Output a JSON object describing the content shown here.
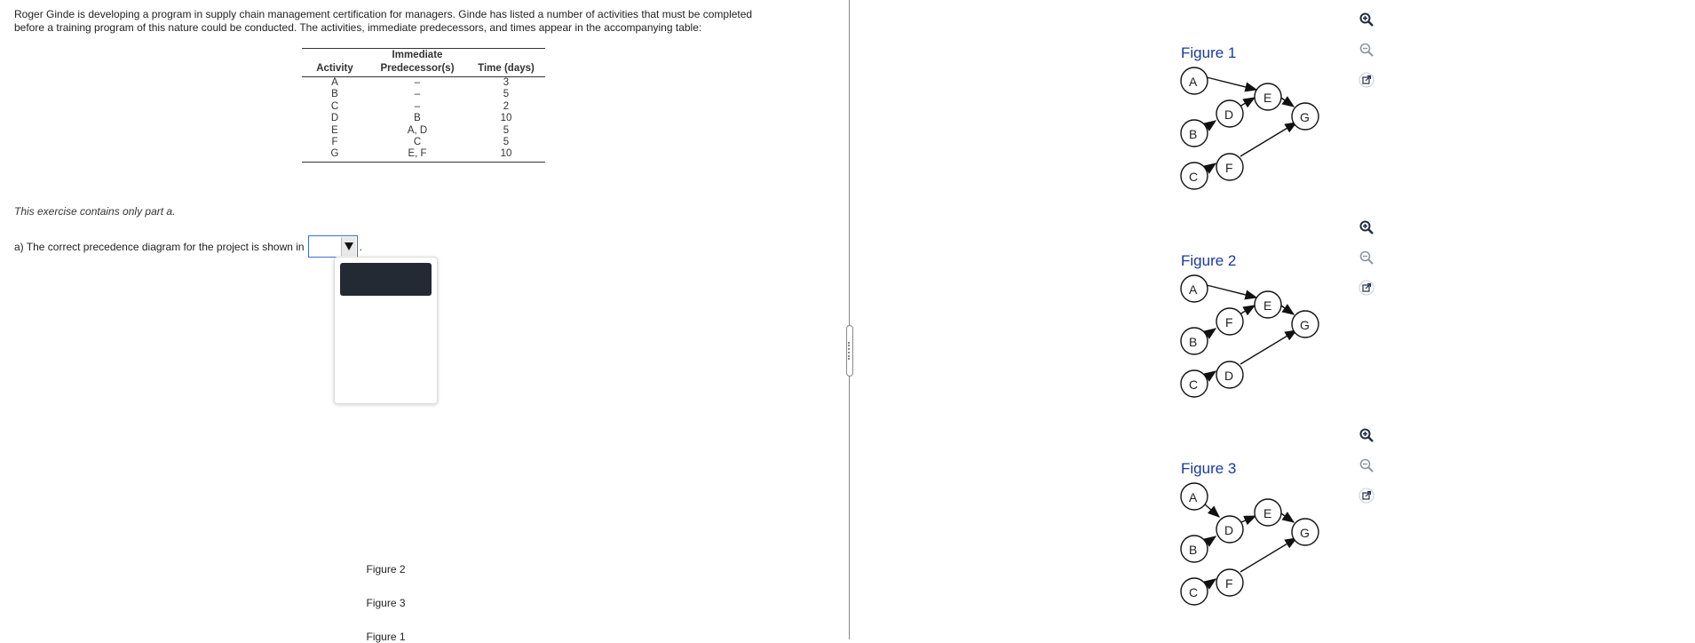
{
  "question": {
    "line1": "Roger Ginde is developing a program in supply chain management certification for managers. Ginde has listed a number of activities that must be completed",
    "line2": "before a training program of this nature could be conducted. The activities, immediate predecessors, and times appear in the accompanying table:"
  },
  "table": {
    "header_top": "Immediate",
    "headers": [
      "Activity",
      "Predecessor(s)",
      "Time (days)"
    ],
    "rows": [
      [
        "A",
        "–",
        "3"
      ],
      [
        "B",
        "–",
        "5"
      ],
      [
        "C",
        "–",
        "2"
      ],
      [
        "D",
        "B",
        "10"
      ],
      [
        "E",
        "A, D",
        "5"
      ],
      [
        "F",
        "C",
        "5"
      ],
      [
        "G",
        "E, F",
        "10"
      ]
    ]
  },
  "part_note": "This exercise contains only part a.",
  "answer": {
    "prompt": "a) The correct precedence diagram for the project is shown in",
    "selected_value": "",
    "period": "."
  },
  "dropdown": {
    "options": [
      "Figure 2",
      "Figure 3",
      "Figure 1"
    ]
  },
  "figures": [
    {
      "title": "Figure 1",
      "nodes": [
        "A",
        "B",
        "C",
        "D",
        "E",
        "F",
        "G"
      ]
    },
    {
      "title": "Figure 2",
      "nodes": [
        "A",
        "B",
        "C",
        "F",
        "E",
        "D",
        "G"
      ]
    },
    {
      "title": "Figure 3",
      "nodes": [
        "A",
        "B",
        "C",
        "D",
        "E",
        "F",
        "G"
      ]
    }
  ],
  "icons": {
    "zoom_in": "zoom-in-icon",
    "zoom_out": "zoom-out-icon",
    "popout": "external-link-icon"
  },
  "colors": {
    "figure_title": "#1a3a9c",
    "select_border": "#3a6fd8",
    "selected_option_bg": "#232a33"
  }
}
